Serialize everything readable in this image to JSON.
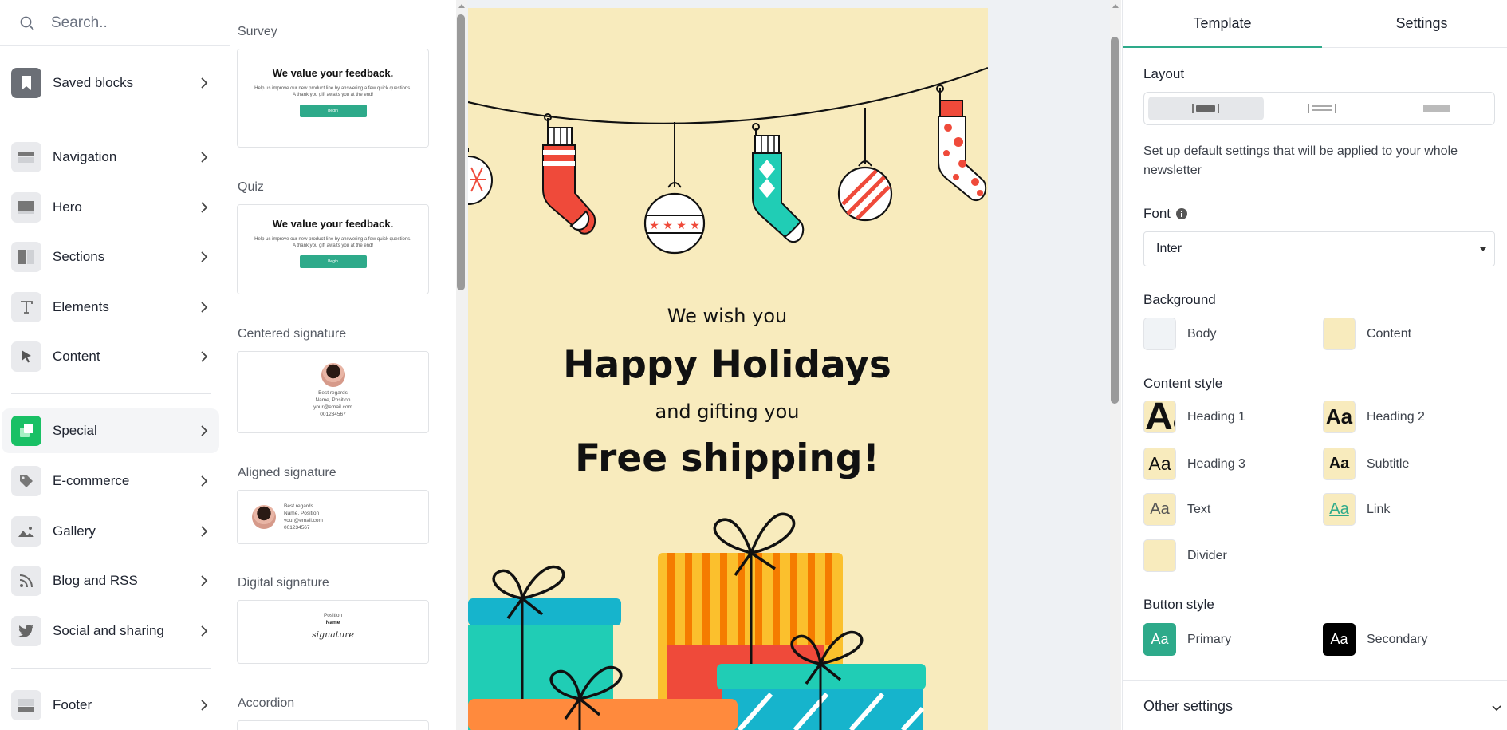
{
  "search": {
    "placeholder": "Search.."
  },
  "sidebar": {
    "items": [
      {
        "label": "Saved blocks"
      },
      {
        "label": "Navigation"
      },
      {
        "label": "Hero"
      },
      {
        "label": "Sections"
      },
      {
        "label": "Elements"
      },
      {
        "label": "Content"
      },
      {
        "label": "Special"
      },
      {
        "label": "E-commerce"
      },
      {
        "label": "Gallery"
      },
      {
        "label": "Blog and RSS"
      },
      {
        "label": "Social and sharing"
      },
      {
        "label": "Footer"
      }
    ],
    "active": "Special"
  },
  "blocks": {
    "survey": {
      "title": "Survey",
      "heading": "We value your feedback.",
      "text": "Help us improve our new product line by answering a few quick questions.",
      "text2": "A thank you gift awaits you at the end!",
      "button": "Begin"
    },
    "quiz": {
      "title": "Quiz",
      "heading": "We value your feedback.",
      "text": "Help us improve our new product line by answering a few quick questions.",
      "text2": "A thank you gift awaits you at the end!",
      "button": "Begin"
    },
    "centered_signature": {
      "title": "Centered signature",
      "lines": [
        "Best regards",
        "Name, Position",
        "your@email.com",
        "001234567"
      ]
    },
    "aligned_signature": {
      "title": "Aligned signature",
      "lines": [
        "Best regards",
        "Name, Position",
        "your@email.com",
        "001234567"
      ]
    },
    "digital_signature": {
      "title": "Digital signature",
      "position": "Position",
      "name": "Name",
      "sig": "signature"
    },
    "accordion": {
      "title": "Accordion"
    }
  },
  "email": {
    "line1": "We wish you",
    "line2": "Happy Holidays",
    "line3": "and gifting you",
    "line4": "Free shipping!"
  },
  "panel": {
    "tabs": [
      "Template",
      "Settings"
    ],
    "active_tab": "Template",
    "layout_label": "Layout",
    "description": "Set up default settings that will be applied to your whole newsletter",
    "font_label": "Font",
    "font_value": "Inter",
    "background_label": "Background",
    "background": [
      {
        "label": "Body",
        "color": "#f0f3f6"
      },
      {
        "label": "Content",
        "color": "#f8ebbd"
      }
    ],
    "content_style_label": "Content style",
    "content_styles": [
      {
        "label": "Heading 1",
        "sample": "Aa"
      },
      {
        "label": "Heading 2",
        "sample": "Aa"
      },
      {
        "label": "Heading 3",
        "sample": "Aa"
      },
      {
        "label": "Subtitle",
        "sample": "Aa"
      },
      {
        "label": "Text",
        "sample": "Aa"
      },
      {
        "label": "Link",
        "sample": "Aa"
      },
      {
        "label": "Divider",
        "sample": ""
      }
    ],
    "button_style_label": "Button style",
    "button_styles": [
      {
        "label": "Primary",
        "sample": "Aa",
        "color": "#2eaa8a"
      },
      {
        "label": "Secondary",
        "sample": "Aa",
        "color": "#000000"
      }
    ],
    "other_settings": "Other settings"
  },
  "colors": {
    "accent": "#2eaa8a",
    "content_bg": "#f8ebbd",
    "special_icon": "#19c065"
  }
}
